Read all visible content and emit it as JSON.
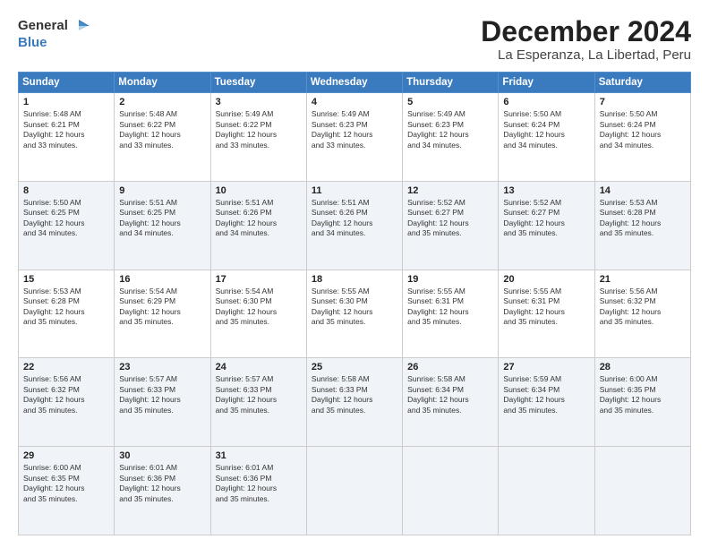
{
  "header": {
    "logo_line1": "General",
    "logo_line2": "Blue",
    "title": "December 2024",
    "subtitle": "La Esperanza, La Libertad, Peru"
  },
  "weekdays": [
    "Sunday",
    "Monday",
    "Tuesday",
    "Wednesday",
    "Thursday",
    "Friday",
    "Saturday"
  ],
  "weeks": [
    [
      {
        "day": "1",
        "info": "Sunrise: 5:48 AM\nSunset: 6:21 PM\nDaylight: 12 hours\nand 33 minutes."
      },
      {
        "day": "2",
        "info": "Sunrise: 5:48 AM\nSunset: 6:22 PM\nDaylight: 12 hours\nand 33 minutes."
      },
      {
        "day": "3",
        "info": "Sunrise: 5:49 AM\nSunset: 6:22 PM\nDaylight: 12 hours\nand 33 minutes."
      },
      {
        "day": "4",
        "info": "Sunrise: 5:49 AM\nSunset: 6:23 PM\nDaylight: 12 hours\nand 33 minutes."
      },
      {
        "day": "5",
        "info": "Sunrise: 5:49 AM\nSunset: 6:23 PM\nDaylight: 12 hours\nand 34 minutes."
      },
      {
        "day": "6",
        "info": "Sunrise: 5:50 AM\nSunset: 6:24 PM\nDaylight: 12 hours\nand 34 minutes."
      },
      {
        "day": "7",
        "info": "Sunrise: 5:50 AM\nSunset: 6:24 PM\nDaylight: 12 hours\nand 34 minutes."
      }
    ],
    [
      {
        "day": "8",
        "info": "Sunrise: 5:50 AM\nSunset: 6:25 PM\nDaylight: 12 hours\nand 34 minutes."
      },
      {
        "day": "9",
        "info": "Sunrise: 5:51 AM\nSunset: 6:25 PM\nDaylight: 12 hours\nand 34 minutes."
      },
      {
        "day": "10",
        "info": "Sunrise: 5:51 AM\nSunset: 6:26 PM\nDaylight: 12 hours\nand 34 minutes."
      },
      {
        "day": "11",
        "info": "Sunrise: 5:51 AM\nSunset: 6:26 PM\nDaylight: 12 hours\nand 34 minutes."
      },
      {
        "day": "12",
        "info": "Sunrise: 5:52 AM\nSunset: 6:27 PM\nDaylight: 12 hours\nand 35 minutes."
      },
      {
        "day": "13",
        "info": "Sunrise: 5:52 AM\nSunset: 6:27 PM\nDaylight: 12 hours\nand 35 minutes."
      },
      {
        "day": "14",
        "info": "Sunrise: 5:53 AM\nSunset: 6:28 PM\nDaylight: 12 hours\nand 35 minutes."
      }
    ],
    [
      {
        "day": "15",
        "info": "Sunrise: 5:53 AM\nSunset: 6:28 PM\nDaylight: 12 hours\nand 35 minutes."
      },
      {
        "day": "16",
        "info": "Sunrise: 5:54 AM\nSunset: 6:29 PM\nDaylight: 12 hours\nand 35 minutes."
      },
      {
        "day": "17",
        "info": "Sunrise: 5:54 AM\nSunset: 6:30 PM\nDaylight: 12 hours\nand 35 minutes."
      },
      {
        "day": "18",
        "info": "Sunrise: 5:55 AM\nSunset: 6:30 PM\nDaylight: 12 hours\nand 35 minutes."
      },
      {
        "day": "19",
        "info": "Sunrise: 5:55 AM\nSunset: 6:31 PM\nDaylight: 12 hours\nand 35 minutes."
      },
      {
        "day": "20",
        "info": "Sunrise: 5:55 AM\nSunset: 6:31 PM\nDaylight: 12 hours\nand 35 minutes."
      },
      {
        "day": "21",
        "info": "Sunrise: 5:56 AM\nSunset: 6:32 PM\nDaylight: 12 hours\nand 35 minutes."
      }
    ],
    [
      {
        "day": "22",
        "info": "Sunrise: 5:56 AM\nSunset: 6:32 PM\nDaylight: 12 hours\nand 35 minutes."
      },
      {
        "day": "23",
        "info": "Sunrise: 5:57 AM\nSunset: 6:33 PM\nDaylight: 12 hours\nand 35 minutes."
      },
      {
        "day": "24",
        "info": "Sunrise: 5:57 AM\nSunset: 6:33 PM\nDaylight: 12 hours\nand 35 minutes."
      },
      {
        "day": "25",
        "info": "Sunrise: 5:58 AM\nSunset: 6:33 PM\nDaylight: 12 hours\nand 35 minutes."
      },
      {
        "day": "26",
        "info": "Sunrise: 5:58 AM\nSunset: 6:34 PM\nDaylight: 12 hours\nand 35 minutes."
      },
      {
        "day": "27",
        "info": "Sunrise: 5:59 AM\nSunset: 6:34 PM\nDaylight: 12 hours\nand 35 minutes."
      },
      {
        "day": "28",
        "info": "Sunrise: 6:00 AM\nSunset: 6:35 PM\nDaylight: 12 hours\nand 35 minutes."
      }
    ],
    [
      {
        "day": "29",
        "info": "Sunrise: 6:00 AM\nSunset: 6:35 PM\nDaylight: 12 hours\nand 35 minutes."
      },
      {
        "day": "30",
        "info": "Sunrise: 6:01 AM\nSunset: 6:36 PM\nDaylight: 12 hours\nand 35 minutes."
      },
      {
        "day": "31",
        "info": "Sunrise: 6:01 AM\nSunset: 6:36 PM\nDaylight: 12 hours\nand 35 minutes."
      },
      null,
      null,
      null,
      null
    ]
  ]
}
